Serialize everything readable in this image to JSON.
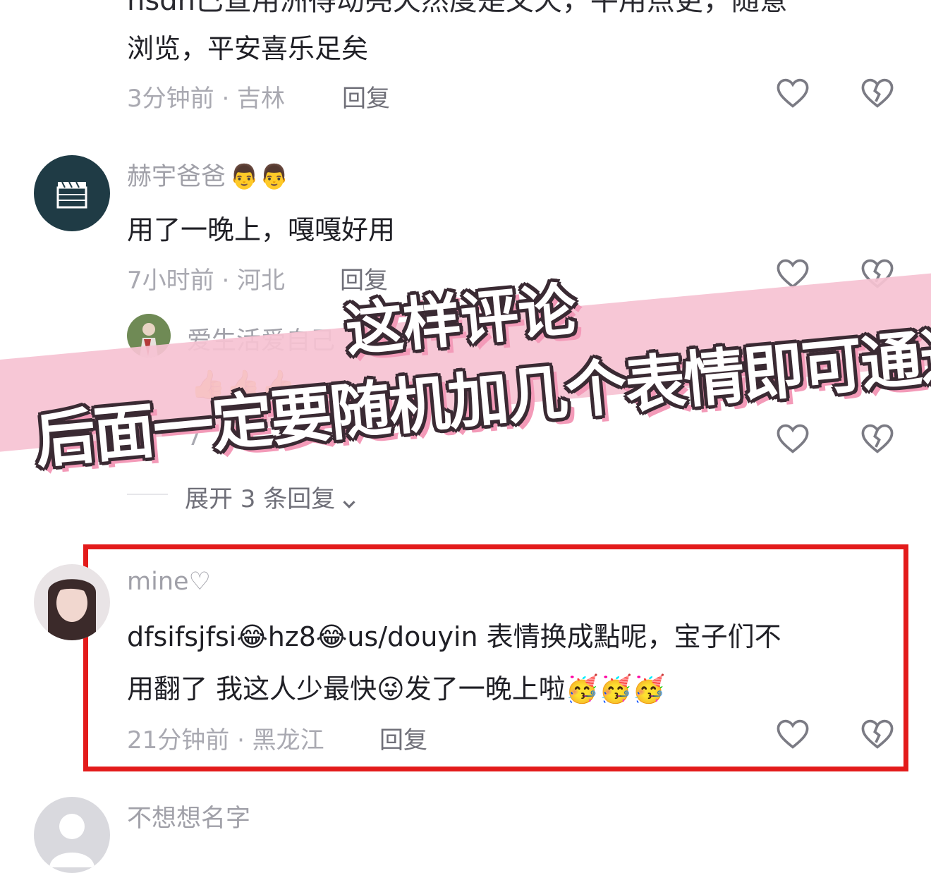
{
  "top_comment": {
    "cut_line": "hsdn已查用洲得动亮天然度是文天，平用点更，随意",
    "line2": "浏览，平安喜乐足矣",
    "time_loc": "3分钟前 · 吉林",
    "reply_label": "回复"
  },
  "comment2": {
    "username": "赫宇爸爸",
    "username_emojis": "👨👨",
    "text": "用了一晚上，嘎嘎好用",
    "time_loc": "7小时前 · 河北",
    "reply_label": "回复"
  },
  "subreply": {
    "username": "爱生活爱自己",
    "text_emojis": "👍👍👍",
    "time_loc": "7",
    "expand_label": "展开 3 条回复"
  },
  "overlay": {
    "line1": "这样评论",
    "line2": "后面一定要随机加几个表情即可通过",
    "banner_color": "#f6c2d3"
  },
  "comment3": {
    "username": "mine♡",
    "text_line1": "dfsifsjfsi😂hz8😂us/douyin 表情换成點呢，宝子们不",
    "text_line2": "用翻了  我这人少最快😜发了一晚上啦🥳🥳🥳",
    "time_loc": "21分钟前 · 黑龙江",
    "reply_label": "回复",
    "highlight_color": "#e31b1b"
  },
  "comment4": {
    "username": "不想想名字"
  },
  "icons": {
    "like": "heart-outline-icon",
    "dislike": "broken-heart-icon"
  }
}
